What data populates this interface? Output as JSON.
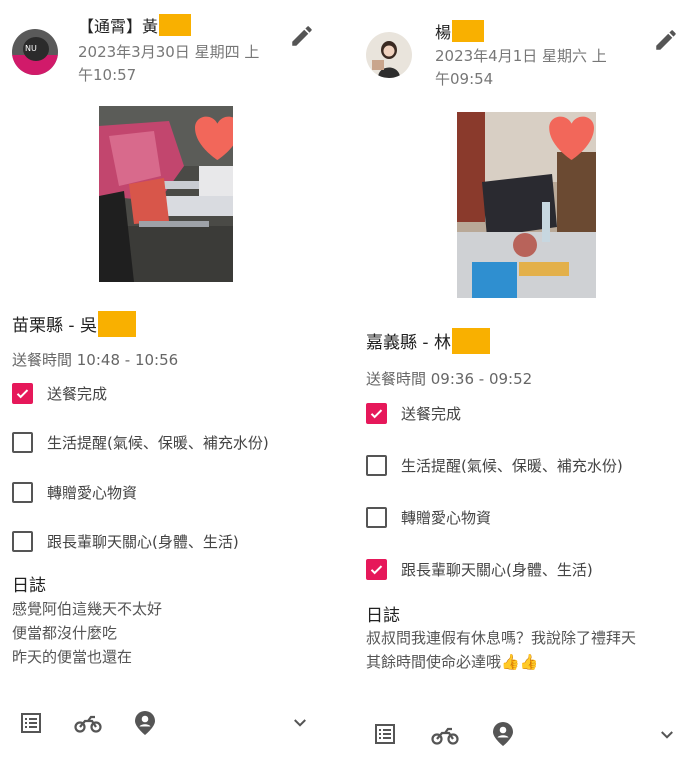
{
  "posts": [
    {
      "author_label": "【通霄】黃",
      "date_line1": "2023年3月30日 星期四 上",
      "date_line2": "午10:57",
      "location_title": "苗栗縣 - 吳",
      "delivery_time": "送餐時間 10:48 - 10:56",
      "checklist": [
        {
          "label": "送餐完成",
          "checked": true
        },
        {
          "label": "生活提醒(氣候、保暖、補充水份)",
          "checked": false
        },
        {
          "label": "轉贈愛心物資",
          "checked": false
        },
        {
          "label": "跟長輩聊天關心(身體、生活)",
          "checked": false
        }
      ],
      "log_heading": "日誌",
      "log_lines": [
        "感覺阿伯這幾天不太好",
        "便當都沒什麼吃",
        "昨天的便當也還在"
      ]
    },
    {
      "author_label": "楊",
      "date_line1": "2023年4月1日 星期六 上",
      "date_line2": "午09:54",
      "location_title": "嘉義縣 - 林",
      "delivery_time": "送餐時間 09:36 - 09:52",
      "checklist": [
        {
          "label": "送餐完成",
          "checked": true
        },
        {
          "label": "生活提醒(氣候、保暖、補充水份)",
          "checked": false
        },
        {
          "label": "轉贈愛心物資",
          "checked": false
        },
        {
          "label": "跟長輩聊天關心(身體、生活)",
          "checked": true
        }
      ],
      "log_heading": "日誌",
      "log_lines": [
        "叔叔問我連假有休息嗎？我說除了禮拜天",
        "其餘時間使命必達哦👍👍"
      ]
    }
  ],
  "icons": {
    "edit": "pencil-icon",
    "list": "list-icon",
    "bike": "motorcycle-icon",
    "location": "location-person-icon",
    "expand": "chevron-down-icon"
  },
  "colors": {
    "checked": "#e6185a",
    "redaction": "#f9b000",
    "heart": "#f2675a"
  }
}
